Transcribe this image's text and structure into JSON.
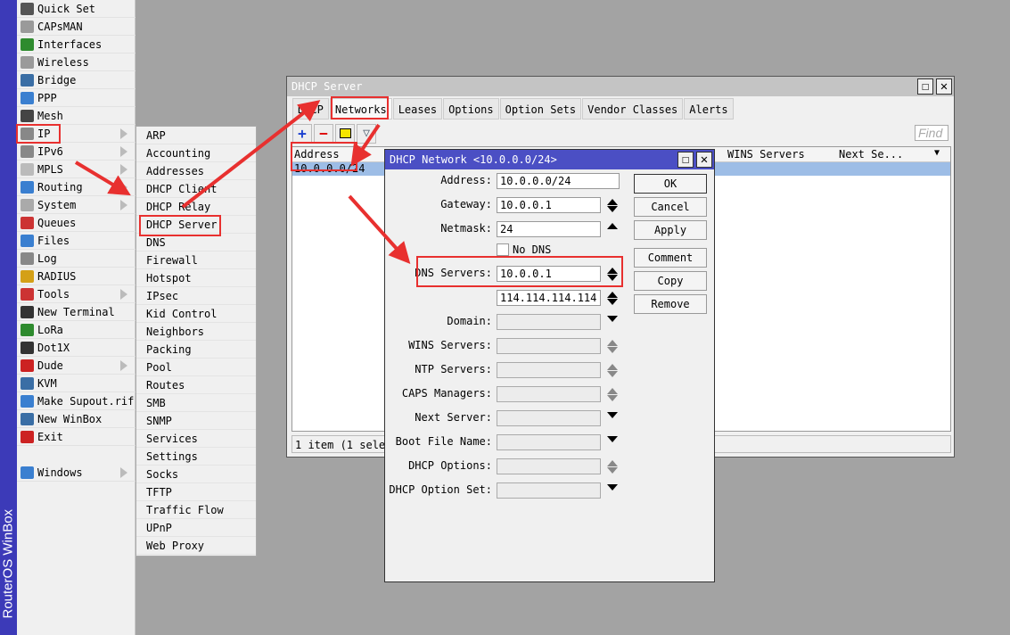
{
  "brand": "RouterOS WinBox",
  "menu": [
    {
      "label": "Quick Set",
      "icon": "wand-icon",
      "color": "#555"
    },
    {
      "label": "CAPsMAN",
      "icon": "antenna-icon",
      "color": "#9a9a9a"
    },
    {
      "label": "Interfaces",
      "icon": "interfaces-icon",
      "color": "#2e8b2e"
    },
    {
      "label": "Wireless",
      "icon": "wireless-icon",
      "color": "#9a9a9a"
    },
    {
      "label": "Bridge",
      "icon": "bridge-icon",
      "color": "#3a6ea5"
    },
    {
      "label": "PPP",
      "icon": "ppp-icon",
      "color": "#3a7fd0"
    },
    {
      "label": "Mesh",
      "icon": "mesh-icon",
      "color": "#444"
    },
    {
      "label": "IP",
      "icon": "ip-icon",
      "color": "#888",
      "sub": true
    },
    {
      "label": "IPv6",
      "icon": "ipv6-icon",
      "color": "#888",
      "sub": true
    },
    {
      "label": "MPLS",
      "icon": "mpls-icon",
      "color": "#bbb",
      "sub": true
    },
    {
      "label": "Routing",
      "icon": "routing-icon",
      "color": "#3a7fd0",
      "sub": true
    },
    {
      "label": "System",
      "icon": "gear-icon",
      "color": "#aaa",
      "sub": true
    },
    {
      "label": "Queues",
      "icon": "queues-icon",
      "color": "#c33"
    },
    {
      "label": "Files",
      "icon": "folder-icon",
      "color": "#3a7fd0"
    },
    {
      "label": "Log",
      "icon": "log-icon",
      "color": "#888"
    },
    {
      "label": "RADIUS",
      "icon": "radius-icon",
      "color": "#d4a017"
    },
    {
      "label": "Tools",
      "icon": "tools-icon",
      "color": "#c33",
      "sub": true
    },
    {
      "label": "New Terminal",
      "icon": "terminal-icon",
      "color": "#333"
    },
    {
      "label": "LoRa",
      "icon": "lora-icon",
      "color": "#2e8b2e"
    },
    {
      "label": "Dot1X",
      "icon": "dot1x-icon",
      "color": "#333"
    },
    {
      "label": "Dude",
      "icon": "dude-icon",
      "color": "#c22",
      "sub": true
    },
    {
      "label": "KVM",
      "icon": "kvm-icon",
      "color": "#3a6ea5"
    },
    {
      "label": "Make Supout.rif",
      "icon": "supout-icon",
      "color": "#3a7fd0"
    },
    {
      "label": "New WinBox",
      "icon": "winbox-icon",
      "color": "#3a6ea5"
    },
    {
      "label": "Exit",
      "icon": "exit-icon",
      "color": "#c22"
    }
  ],
  "windows_item": {
    "label": "Windows",
    "icon": "windows-icon",
    "color": "#3a7fd0"
  },
  "submenu": [
    "ARP",
    "Accounting",
    "Addresses",
    "DHCP Client",
    "DHCP Relay",
    "DHCP Server",
    "DNS",
    "Firewall",
    "Hotspot",
    "IPsec",
    "Kid Control",
    "Neighbors",
    "Packing",
    "Pool",
    "Routes",
    "SMB",
    "SNMP",
    "Services",
    "Settings",
    "Socks",
    "TFTP",
    "Traffic Flow",
    "UPnP",
    "Web Proxy"
  ],
  "dhcp_window": {
    "title": "DHCP Server",
    "tabs": [
      "DHCP",
      "Networks",
      "Leases",
      "Options",
      "Option Sets",
      "Vendor Classes",
      "Alerts"
    ],
    "active_tab": "Networks",
    "find_placeholder": "Find",
    "columns": [
      "Address",
      "WINS Servers",
      "Next Se..."
    ],
    "rows": [
      {
        "address": "10.0.0.0/24"
      }
    ],
    "status": "1 item (1 selected)"
  },
  "dialog": {
    "title": "DHCP Network <10.0.0.0/24>",
    "fields": {
      "address": {
        "label": "Address:",
        "value": "10.0.0.0/24"
      },
      "gateway": {
        "label": "Gateway:",
        "value": "10.0.0.1"
      },
      "netmask": {
        "label": "Netmask:",
        "value": "24"
      },
      "no_dns": {
        "label": "No DNS",
        "checked": false
      },
      "dns": {
        "label": "DNS Servers:",
        "value": "10.0.0.1",
        "value2": "114.114.114.114"
      },
      "domain": {
        "label": "Domain:",
        "value": ""
      },
      "wins": {
        "label": "WINS Servers:",
        "value": ""
      },
      "ntp": {
        "label": "NTP Servers:",
        "value": ""
      },
      "caps": {
        "label": "CAPS Managers:",
        "value": ""
      },
      "next_server": {
        "label": "Next Server:",
        "value": ""
      },
      "boot_file": {
        "label": "Boot File Name:",
        "value": ""
      },
      "dhcp_options": {
        "label": "DHCP Options:",
        "value": ""
      },
      "dhcp_option_set": {
        "label": "DHCP Option Set:",
        "value": ""
      }
    },
    "buttons": [
      "OK",
      "Cancel",
      "Apply",
      "Comment",
      "Copy",
      "Remove"
    ]
  },
  "annotation_color": "#e8302f"
}
